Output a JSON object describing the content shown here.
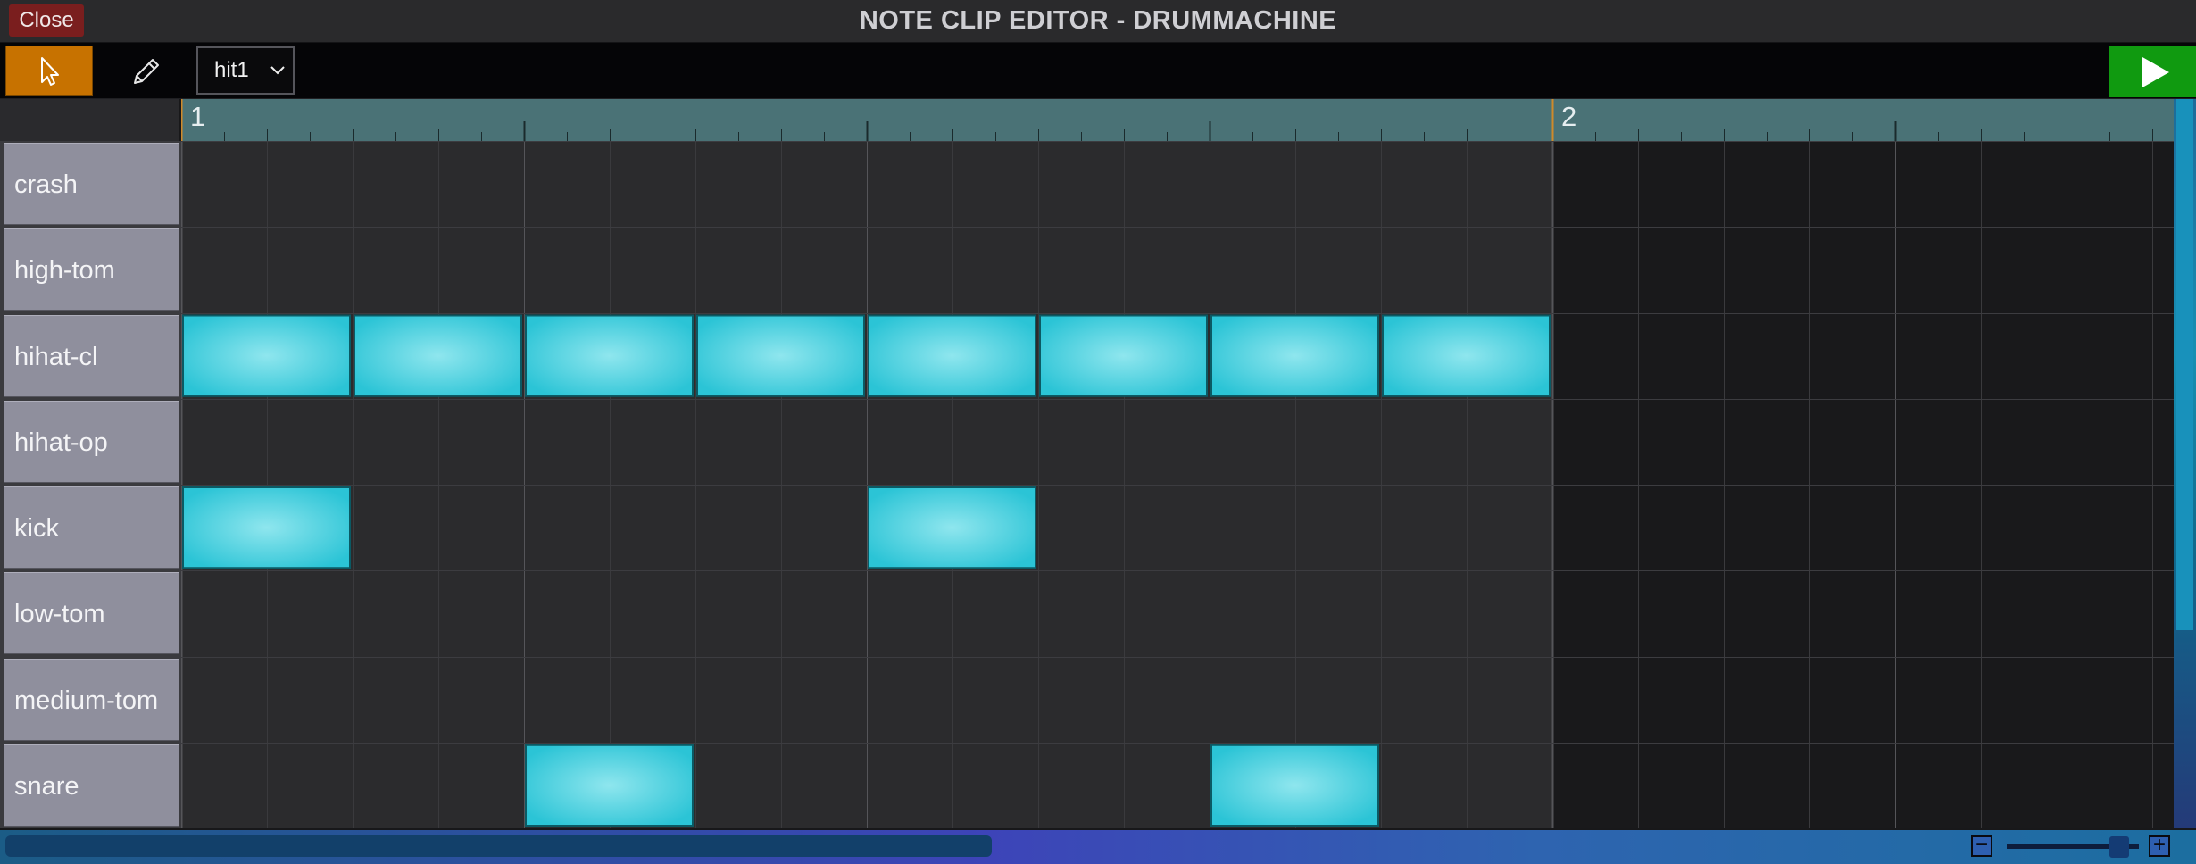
{
  "window": {
    "title": "NOTE CLIP EDITOR - DRUMMACHINE",
    "close_label": "Close"
  },
  "toolbar": {
    "tools": [
      {
        "name": "select",
        "icon": "arrow-cursor-icon",
        "active": true
      },
      {
        "name": "pencil",
        "icon": "pencil-icon",
        "active": false
      }
    ],
    "clip_selector": {
      "selected": "hit1"
    },
    "play_icon": "play-icon"
  },
  "ruler": {
    "bar_labels": [
      "1",
      "2"
    ]
  },
  "keys": [
    {
      "label": "crash"
    },
    {
      "label": "high-tom"
    },
    {
      "label": "hihat-cl"
    },
    {
      "label": "hihat-op"
    },
    {
      "label": "kick"
    },
    {
      "label": "low-tom"
    },
    {
      "label": "medium-tom"
    },
    {
      "label": "snare"
    }
  ],
  "notes": [
    {
      "row": "hihat-cl",
      "start_step": 0,
      "length_steps": 2
    },
    {
      "row": "hihat-cl",
      "start_step": 2,
      "length_steps": 2
    },
    {
      "row": "hihat-cl",
      "start_step": 4,
      "length_steps": 2
    },
    {
      "row": "hihat-cl",
      "start_step": 6,
      "length_steps": 2
    },
    {
      "row": "hihat-cl",
      "start_step": 8,
      "length_steps": 2
    },
    {
      "row": "hihat-cl",
      "start_step": 10,
      "length_steps": 2
    },
    {
      "row": "hihat-cl",
      "start_step": 12,
      "length_steps": 2
    },
    {
      "row": "hihat-cl",
      "start_step": 14,
      "length_steps": 2
    },
    {
      "row": "kick",
      "start_step": 0,
      "length_steps": 2
    },
    {
      "row": "kick",
      "start_step": 8,
      "length_steps": 2
    },
    {
      "row": "snare",
      "start_step": 4,
      "length_steps": 2
    },
    {
      "row": "snare",
      "start_step": 12,
      "length_steps": 2
    }
  ],
  "zoom": {
    "out_label": "−",
    "in_label": "+",
    "level": 0.85
  },
  "colors": {
    "accent_tool": "#c77200",
    "note": "#2bc4d6",
    "play": "#109a10",
    "close": "#7a1e1e",
    "ruler": "#4a7276"
  }
}
